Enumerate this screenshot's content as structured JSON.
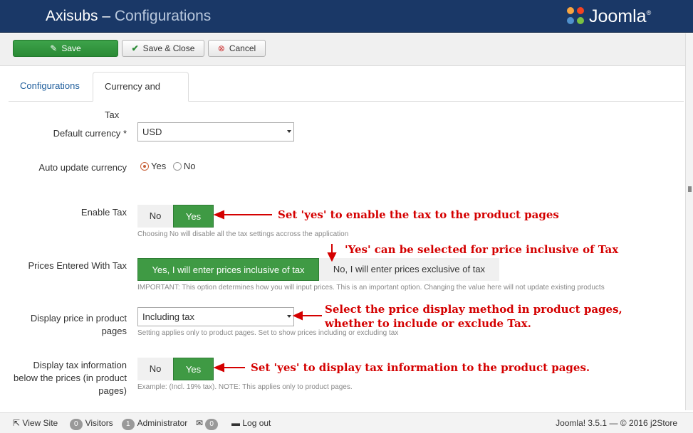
{
  "header": {
    "app": "Axisubs",
    "separator": " – ",
    "section": "Configurations",
    "logo_text": "Joomla!"
  },
  "toolbar": {
    "save": "Save",
    "save_close": "Save & Close",
    "cancel": "Cancel"
  },
  "tabs": [
    {
      "label": "Configurations"
    },
    {
      "label": "Currency and Tax"
    }
  ],
  "form": {
    "default_currency": {
      "label": "Default currency",
      "required_mark": "*",
      "value": "USD"
    },
    "auto_update_currency": {
      "label": "Auto update currency",
      "yes": "Yes",
      "no": "No",
      "selected": "Yes"
    },
    "enable_tax": {
      "label": "Enable Tax",
      "no": "No",
      "yes": "Yes",
      "help": "Choosing No will disable all the tax settings accross the application"
    },
    "prices_entered_with_tax": {
      "label": "Prices Entered With Tax",
      "option_inclusive": "Yes, I will enter prices inclusive of tax",
      "option_exclusive": "No, I will enter prices exclusive of tax",
      "help": "IMPORTANT: This option determines how you will input prices. This is an important option. Changing the value here will not update existing products"
    },
    "display_price": {
      "label_line1": "Display price in product",
      "label_line2": "pages",
      "value": "Including tax",
      "help": "Setting applies only to product pages. Set to show prices including or excluding tax"
    },
    "display_tax_info": {
      "label_line1": "Display tax information",
      "label_line2": "below the prices (in product",
      "label_line3": "pages)",
      "no": "No",
      "yes": "Yes",
      "help": "Example: (Incl. 19% tax). NOTE: This applies only to product pages."
    }
  },
  "annotations": {
    "enable_tax": "Set 'yes' to enable the tax to the product pages",
    "prices_with_tax": "'Yes' can be selected for price inclusive of Tax",
    "display_price_1": "Select the price display method in product pages,",
    "display_price_2": "whether to include or exclude Tax.",
    "display_tax_info": "Set 'yes' to display tax information to the product pages.",
    "color": "#d40000"
  },
  "footer": {
    "view_site": "View Site",
    "visitors_count": "0",
    "visitors": "Visitors",
    "admin_count": "1",
    "administrator": "Administrator",
    "msg_count": "0",
    "logout": "Log out",
    "version": "Joomla! 3.5.1  —  © 2016 j2Store"
  }
}
